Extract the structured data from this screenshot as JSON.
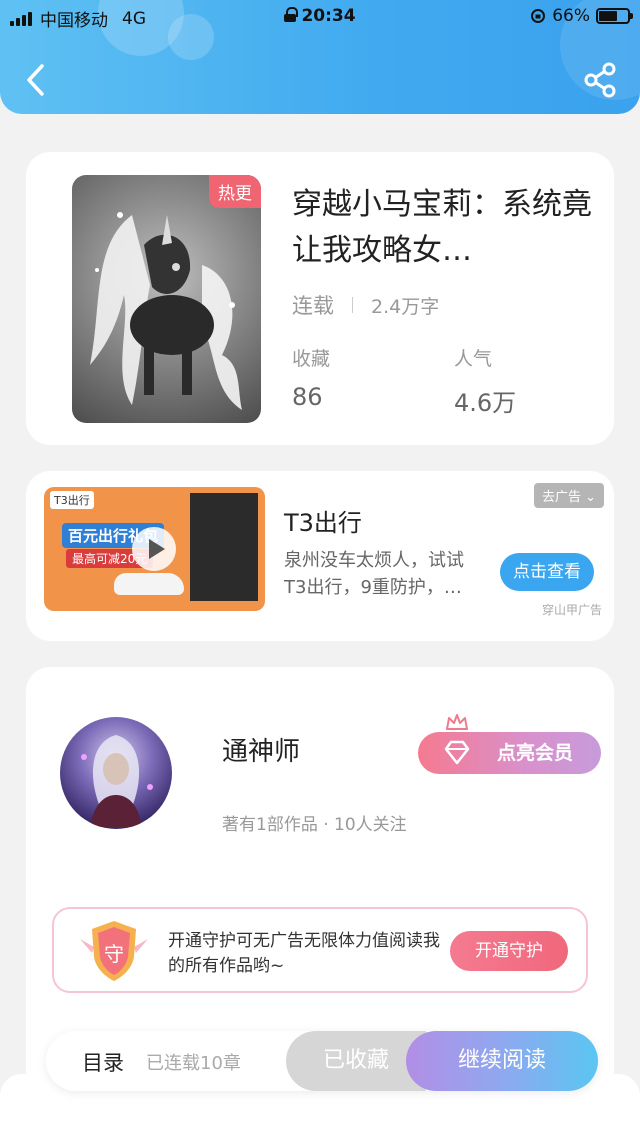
{
  "status_bar": {
    "carrier": "中国移动",
    "network": "4G",
    "time": "20:34",
    "battery": "66%",
    "battery_level": 0.66
  },
  "book": {
    "tag": "热更",
    "title": "穿越小马宝莉：系统竟让我攻略女…",
    "status": "连载",
    "word_count": "2.4万字",
    "favorites_label": "收藏",
    "favorites_value": "86",
    "popularity_label": "人气",
    "popularity_value": "4.6万"
  },
  "ad": {
    "thumb_brand": "T3出行",
    "thumb_headline": "百元出行礼包",
    "thumb_sub": "最高可减20元",
    "title": "T3出行",
    "description": "泉州没车太烦人，试试T3出行，9重防护，…",
    "close_label": "去广告",
    "button_label": "点击查看",
    "source": "穿山甲广告"
  },
  "author": {
    "name": "通神师",
    "subtitle": "著有1部作品 · 10人关注",
    "vip_button": "点亮会员",
    "guard_badge": "守",
    "guard_text": "开通守护可无广告无限体力值阅读我的所有作品哟~",
    "guard_button": "开通守护"
  },
  "bottom_bar": {
    "toc_label": "目录",
    "toc_sub": "已连载10章",
    "favorite_button": "已收藏",
    "read_button": "继续阅读"
  },
  "colors": {
    "header": "#40a9ef",
    "accent_blue": "#3aa6ef",
    "accent_pink": "#f0687c",
    "tag_red": "#ef6672"
  },
  "icons": {
    "back": "chevron-left-icon",
    "share": "share-icon",
    "crown": "crown-icon",
    "diamond": "diamond-icon",
    "play": "play-icon"
  }
}
